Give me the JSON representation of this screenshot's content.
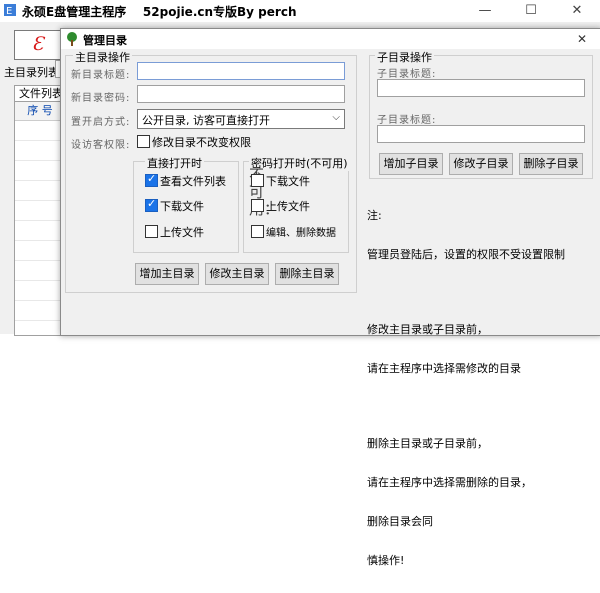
{
  "main_window": {
    "title": "永硕E盘管理主程序",
    "subtitle": "52pojie.cn专版By perch",
    "controls": {
      "minimize": "—",
      "maximize": "☐",
      "close": "✕"
    },
    "main_dir_label": "主目录列表:",
    "file_list_tab": "文件列表",
    "table_header": "序 号"
  },
  "dialog": {
    "title": "管理目录",
    "close": "✕",
    "main_dir_group": {
      "label": "主目录操作",
      "new_dir_title_label": "新目录标题:",
      "new_dir_title_value": "",
      "new_dir_password_label": "新目录密码:",
      "new_dir_password_value": "",
      "open_mode_label": "置开启方式:",
      "open_mode_value": "公开目录, 访客可直接打开",
      "visitor_perm_label": "设访客权限:",
      "keep_perm_checkbox_label": "修改目录不改变权限",
      "direct_open_group": {
        "label": "直接打开时",
        "view_files": "查看文件列表",
        "download": "下载文件",
        "upload": "上传文件"
      },
      "password_open_group": {
        "label": "密码打开时(不可用)",
        "unavailable_text": "不可用：",
        "download": "下载文件",
        "upload": "上传文件",
        "edit_delete": "编辑、删除数据"
      },
      "buttons": {
        "add": "增加主目录",
        "edit": "修改主目录",
        "delete": "删除主目录"
      }
    },
    "sub_dir_group": {
      "label": "子目录操作",
      "sub_dir_title_label_1": "子目录标题:",
      "sub_dir_title_label_2": "子目录标题:",
      "buttons": {
        "add": "增加子目录",
        "edit": "修改子目录",
        "delete": "删除子目录"
      }
    },
    "notes": {
      "heading": "注:",
      "line1": "管理员登陆后，设置的权限不受设置限制",
      "line2": "修改主目录或子目录前，",
      "line3": "请在主程序中选择需修改的目录",
      "line4": "删除主目录或子目录前，",
      "line5": "请在主程序中选择需删除的目录，",
      "line6": "删除目录会同",
      "line7": "慎操作!"
    }
  }
}
